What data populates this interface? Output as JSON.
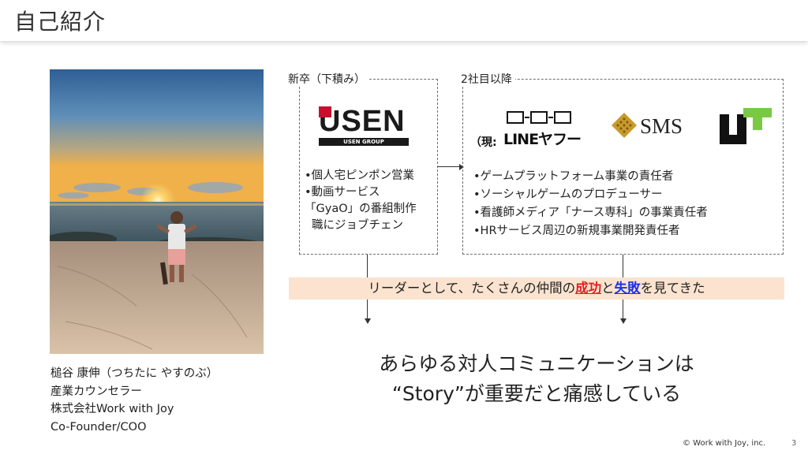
{
  "slide": {
    "title": "自己紹介",
    "page_number": "3",
    "footer": "© Work with Joy, inc."
  },
  "profile": {
    "name": "槌谷 康伸（つちたに やすのぶ）",
    "role": "産業カウンセラー",
    "company": "株式会社Work with Joy",
    "position": "Co-Founder/COO"
  },
  "career": {
    "new_grad_label": "新卒（下積み）",
    "later_label": "2社目以降",
    "usen": {
      "logo_text": "USEN",
      "logo_sub": "USEN GROUP",
      "bullets": [
        "•個人宅ピンポン営業",
        "•動画サービス",
        "「GyaO」の番組制作",
        "職にジョブチェン"
      ]
    },
    "later": {
      "current_prefix": "（現:",
      "line_yahoo": "LINEヤフー",
      "sms": "SMS",
      "ut": "UT",
      "bullets": [
        "•ゲームプラットフォーム事業の責任者",
        "•ソーシャルゲームのプロデューサー",
        "•看護師メディア「ナース専科」の事業責任者",
        "•HRサービス周辺の新規事業開発責任者"
      ]
    }
  },
  "banner": {
    "prefix": "リーダーとして、たくさんの仲間の",
    "success": "成功",
    "and": "と",
    "failure": "失敗",
    "suffix": "を見てきた"
  },
  "conclusion": {
    "line1": "あらゆる対人コミュニケーションは",
    "line2": "“Story”が重要だと痛感している"
  },
  "colors": {
    "success": "#e02020",
    "failure": "#1a33e6",
    "banner_bg": "#fbe3cf",
    "usen_red": "#c8102e",
    "ut_green": "#7ac943"
  }
}
